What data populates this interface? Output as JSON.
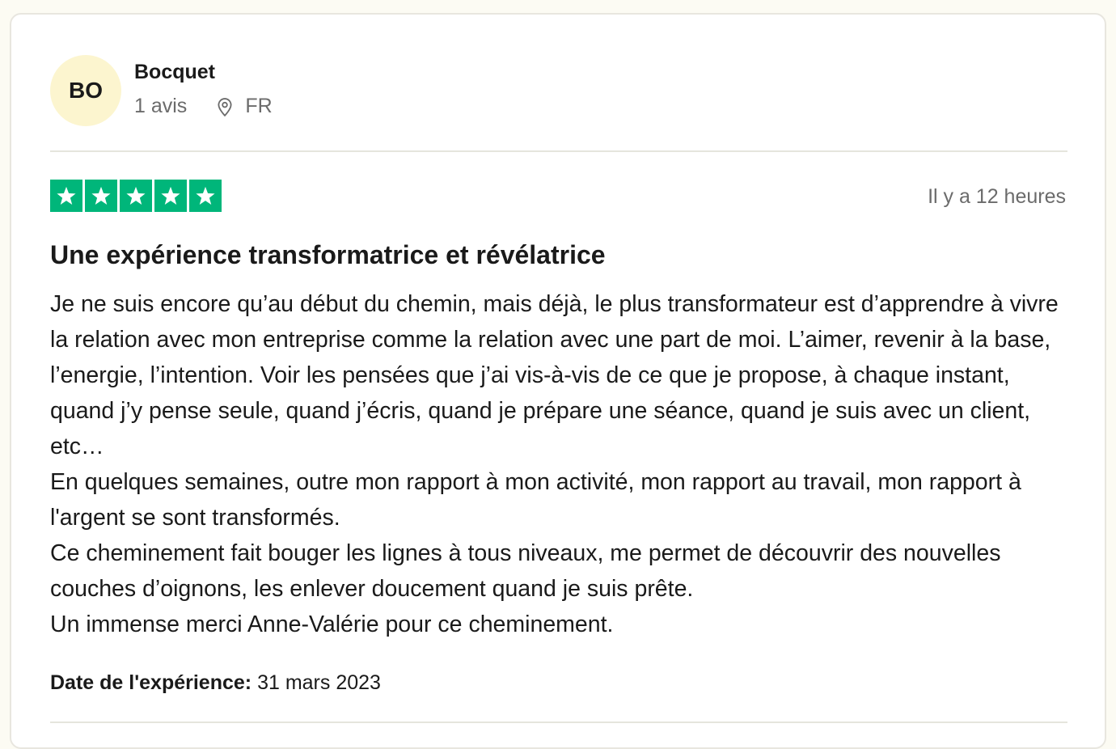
{
  "consumer": {
    "initials": "BO",
    "name": "Bocquet",
    "review_count": "1 avis",
    "country": "FR"
  },
  "review": {
    "rating": 5,
    "rating_max": 5,
    "date_ago": "Il y a 12 heures",
    "title": "Une expérience transformatrice et révélatrice",
    "paragraphs": [
      "Je ne suis encore qu’au début du chemin, mais déjà, le plus transformateur est d’apprendre à vivre la relation avec mon entreprise comme la relation avec une part de moi. L’aimer, revenir à la base, l’energie, l’intention. Voir les pensées que j’ai vis-à-vis de ce que je propose, à chaque instant, quand j’y pense seule, quand j’écris, quand je prépare une séance, quand je suis avec un client, etc…",
      "En quelques semaines, outre mon rapport à mon activité, mon rapport au travail, mon rapport à l'argent se sont transformés.",
      "Ce cheminement fait bouger les lignes à tous niveaux, me permet de découvrir des nouvelles couches d’oignons, les enlever doucement quand je suis prête.",
      "Un immense merci Anne-Valérie pour ce cheminement."
    ],
    "experience_label": "Date de l'expérience:",
    "experience_date": "31 mars 2023"
  },
  "colors": {
    "star_green": "#00b67a",
    "avatar_bg": "#fcf5cf",
    "page_bg": "#fcfbf3"
  },
  "icons": {
    "location": "location-pin-icon",
    "star": "star-icon"
  }
}
